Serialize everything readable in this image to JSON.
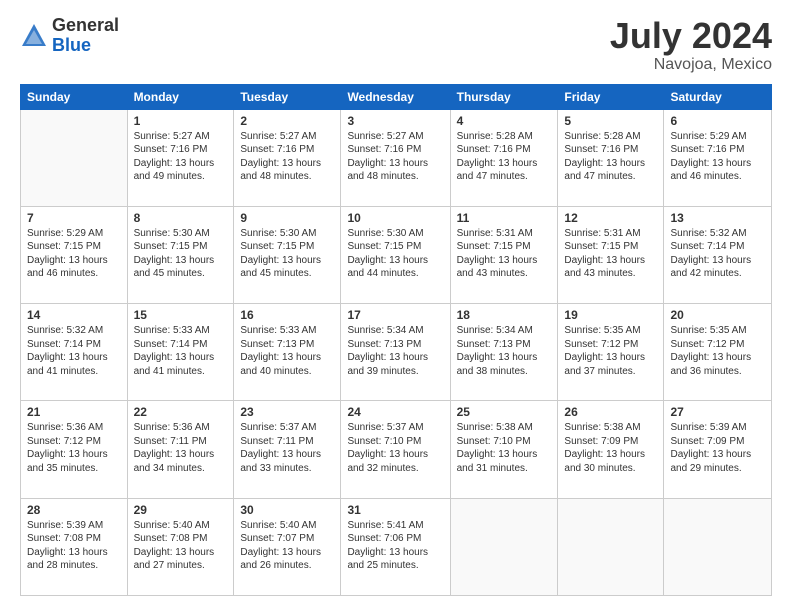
{
  "header": {
    "logo_general": "General",
    "logo_blue": "Blue",
    "month_title": "July 2024",
    "location": "Navojoa, Mexico"
  },
  "days_of_week": [
    "Sunday",
    "Monday",
    "Tuesday",
    "Wednesday",
    "Thursday",
    "Friday",
    "Saturday"
  ],
  "weeks": [
    [
      {
        "day": "",
        "info": ""
      },
      {
        "day": "1",
        "info": "Sunrise: 5:27 AM\nSunset: 7:16 PM\nDaylight: 13 hours\nand 49 minutes."
      },
      {
        "day": "2",
        "info": "Sunrise: 5:27 AM\nSunset: 7:16 PM\nDaylight: 13 hours\nand 48 minutes."
      },
      {
        "day": "3",
        "info": "Sunrise: 5:27 AM\nSunset: 7:16 PM\nDaylight: 13 hours\nand 48 minutes."
      },
      {
        "day": "4",
        "info": "Sunrise: 5:28 AM\nSunset: 7:16 PM\nDaylight: 13 hours\nand 47 minutes."
      },
      {
        "day": "5",
        "info": "Sunrise: 5:28 AM\nSunset: 7:16 PM\nDaylight: 13 hours\nand 47 minutes."
      },
      {
        "day": "6",
        "info": "Sunrise: 5:29 AM\nSunset: 7:16 PM\nDaylight: 13 hours\nand 46 minutes."
      }
    ],
    [
      {
        "day": "7",
        "info": "Sunrise: 5:29 AM\nSunset: 7:15 PM\nDaylight: 13 hours\nand 46 minutes."
      },
      {
        "day": "8",
        "info": "Sunrise: 5:30 AM\nSunset: 7:15 PM\nDaylight: 13 hours\nand 45 minutes."
      },
      {
        "day": "9",
        "info": "Sunrise: 5:30 AM\nSunset: 7:15 PM\nDaylight: 13 hours\nand 45 minutes."
      },
      {
        "day": "10",
        "info": "Sunrise: 5:30 AM\nSunset: 7:15 PM\nDaylight: 13 hours\nand 44 minutes."
      },
      {
        "day": "11",
        "info": "Sunrise: 5:31 AM\nSunset: 7:15 PM\nDaylight: 13 hours\nand 43 minutes."
      },
      {
        "day": "12",
        "info": "Sunrise: 5:31 AM\nSunset: 7:15 PM\nDaylight: 13 hours\nand 43 minutes."
      },
      {
        "day": "13",
        "info": "Sunrise: 5:32 AM\nSunset: 7:14 PM\nDaylight: 13 hours\nand 42 minutes."
      }
    ],
    [
      {
        "day": "14",
        "info": "Sunrise: 5:32 AM\nSunset: 7:14 PM\nDaylight: 13 hours\nand 41 minutes."
      },
      {
        "day": "15",
        "info": "Sunrise: 5:33 AM\nSunset: 7:14 PM\nDaylight: 13 hours\nand 41 minutes."
      },
      {
        "day": "16",
        "info": "Sunrise: 5:33 AM\nSunset: 7:13 PM\nDaylight: 13 hours\nand 40 minutes."
      },
      {
        "day": "17",
        "info": "Sunrise: 5:34 AM\nSunset: 7:13 PM\nDaylight: 13 hours\nand 39 minutes."
      },
      {
        "day": "18",
        "info": "Sunrise: 5:34 AM\nSunset: 7:13 PM\nDaylight: 13 hours\nand 38 minutes."
      },
      {
        "day": "19",
        "info": "Sunrise: 5:35 AM\nSunset: 7:12 PM\nDaylight: 13 hours\nand 37 minutes."
      },
      {
        "day": "20",
        "info": "Sunrise: 5:35 AM\nSunset: 7:12 PM\nDaylight: 13 hours\nand 36 minutes."
      }
    ],
    [
      {
        "day": "21",
        "info": "Sunrise: 5:36 AM\nSunset: 7:12 PM\nDaylight: 13 hours\nand 35 minutes."
      },
      {
        "day": "22",
        "info": "Sunrise: 5:36 AM\nSunset: 7:11 PM\nDaylight: 13 hours\nand 34 minutes."
      },
      {
        "day": "23",
        "info": "Sunrise: 5:37 AM\nSunset: 7:11 PM\nDaylight: 13 hours\nand 33 minutes."
      },
      {
        "day": "24",
        "info": "Sunrise: 5:37 AM\nSunset: 7:10 PM\nDaylight: 13 hours\nand 32 minutes."
      },
      {
        "day": "25",
        "info": "Sunrise: 5:38 AM\nSunset: 7:10 PM\nDaylight: 13 hours\nand 31 minutes."
      },
      {
        "day": "26",
        "info": "Sunrise: 5:38 AM\nSunset: 7:09 PM\nDaylight: 13 hours\nand 30 minutes."
      },
      {
        "day": "27",
        "info": "Sunrise: 5:39 AM\nSunset: 7:09 PM\nDaylight: 13 hours\nand 29 minutes."
      }
    ],
    [
      {
        "day": "28",
        "info": "Sunrise: 5:39 AM\nSunset: 7:08 PM\nDaylight: 13 hours\nand 28 minutes."
      },
      {
        "day": "29",
        "info": "Sunrise: 5:40 AM\nSunset: 7:08 PM\nDaylight: 13 hours\nand 27 minutes."
      },
      {
        "day": "30",
        "info": "Sunrise: 5:40 AM\nSunset: 7:07 PM\nDaylight: 13 hours\nand 26 minutes."
      },
      {
        "day": "31",
        "info": "Sunrise: 5:41 AM\nSunset: 7:06 PM\nDaylight: 13 hours\nand 25 minutes."
      },
      {
        "day": "",
        "info": ""
      },
      {
        "day": "",
        "info": ""
      },
      {
        "day": "",
        "info": ""
      }
    ]
  ]
}
